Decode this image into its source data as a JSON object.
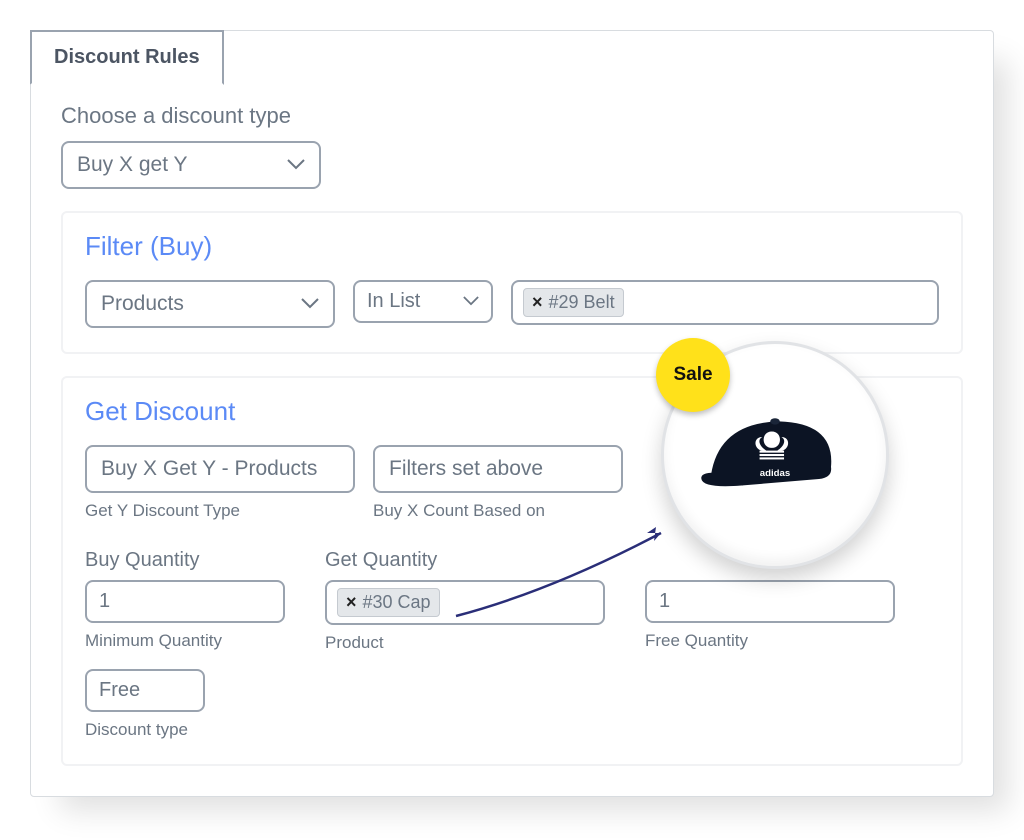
{
  "tab_label": "Discount Rules",
  "choose_label": "Choose a discount type",
  "discount_type_selected": "Buy X get Y",
  "filter": {
    "title": "Filter (Buy)",
    "scope_selected": "Products",
    "op_selected": "In List",
    "tag": "#29 Belt"
  },
  "get": {
    "title": "Get Discount",
    "y_type_value": "Buy X Get Y - Products",
    "y_type_sub": "Get Y Discount Type",
    "count_value": "Filters set above",
    "count_sub": "Buy X Count Based on",
    "buy_qty_label": "Buy Quantity",
    "buy_qty_value": "1",
    "buy_qty_sub": "Minimum Quantity",
    "get_qty_label": "Get Quantity",
    "product_tag": "#30 Cap",
    "product_sub": "Product",
    "free_qty_value": "1",
    "free_qty_sub": "Free Quantity",
    "disc_type_value": "Free",
    "disc_type_sub": "Discount type"
  },
  "badge": "Sale",
  "icons": {
    "chevron": "chevron-down"
  }
}
